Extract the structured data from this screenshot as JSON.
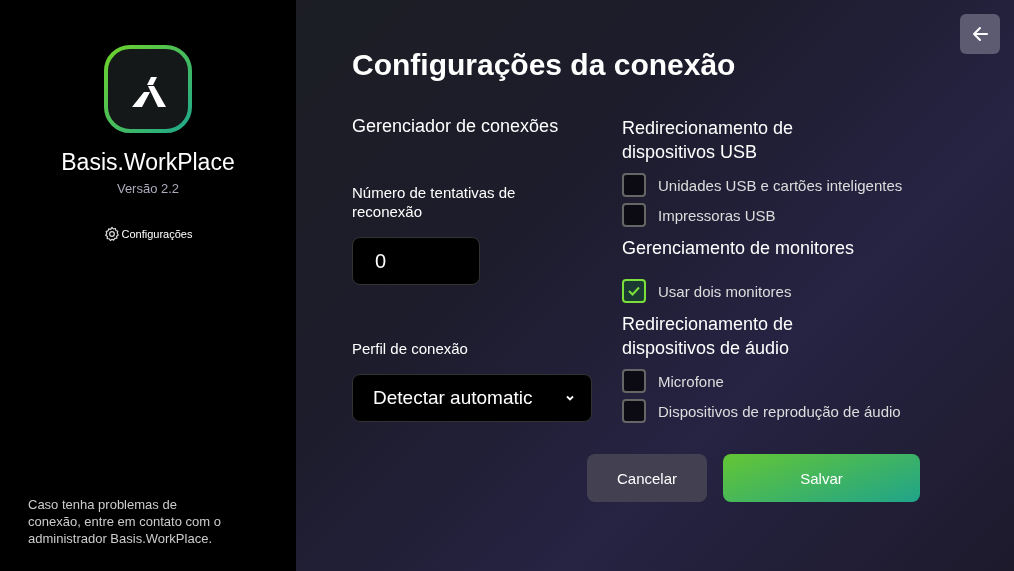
{
  "sidebar": {
    "app_name": "Basis.WorkPlace",
    "version": "Versão 2.2",
    "settings_link": "Configurações",
    "help_text": "Caso tenha problemas de conexão, entre em contato com o administrador Basis.WorkPlace."
  },
  "title": "Configurações da conexão",
  "connection_manager": {
    "heading": "Gerenciador de conexões",
    "retries_label": "Número de tentativas de reconexão",
    "retries_value": "0",
    "profile_label": "Perfil de conexão",
    "profile_value": "Detectar automatic"
  },
  "groups": [
    {
      "heading": "Redirecionamento de dispositivos USB",
      "options": [
        {
          "label": "Unidades USB e cartões inteligentes",
          "checked": false
        },
        {
          "label": "Impressoras USB",
          "checked": false
        }
      ]
    },
    {
      "heading": "Gerenciamento de monitores",
      "options": [
        {
          "label": "Usar dois monitores",
          "checked": true
        }
      ]
    },
    {
      "heading": "Redirecionamento de dispositivos de áudio",
      "options": [
        {
          "label": "Microfone",
          "checked": false
        },
        {
          "label": "Dispositivos de reprodução de áudio",
          "checked": false
        }
      ]
    }
  ],
  "buttons": [
    {
      "label": "Cancelar",
      "kind": "secondary"
    },
    {
      "label": "Salvar",
      "kind": "primary"
    }
  ]
}
